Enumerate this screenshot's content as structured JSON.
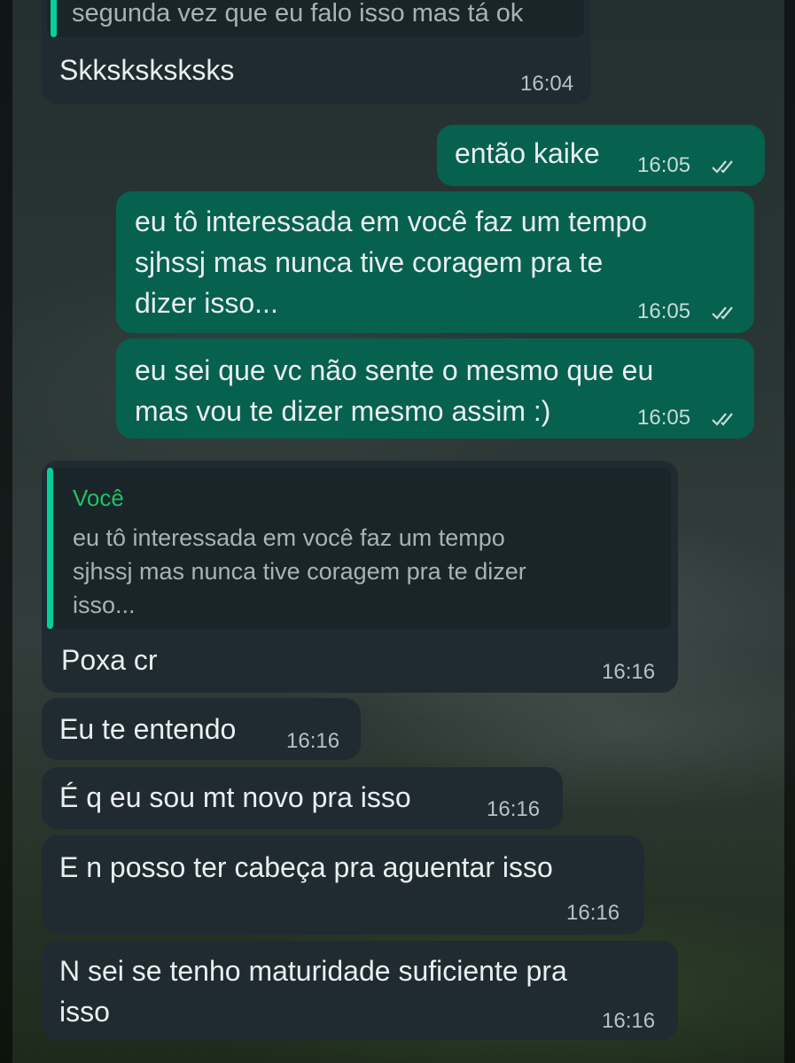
{
  "messages": [
    {
      "quote_text": "segunda vez que eu falo isso mas tá ok",
      "text": "Skksksksksks",
      "time": "16:04"
    },
    {
      "text": "então kaike",
      "time": "16:05"
    },
    {
      "lines": [
        "eu tô interessada em você faz um tempo",
        "sjhssj mas nunca tive coragem pra te",
        "dizer isso..."
      ],
      "time": "16:05"
    },
    {
      "lines": [
        "eu sei que vc não sente o mesmo que eu",
        "mas vou te dizer mesmo assim :)"
      ],
      "time": "16:05"
    },
    {
      "quote_author": "Você",
      "quote_lines": [
        "eu tô interessada em você faz um tempo",
        "sjhssj mas nunca tive coragem pra te dizer",
        "isso..."
      ],
      "text": "Poxa cr",
      "time": "16:16"
    },
    {
      "text": "Eu te entendo",
      "time": "16:16"
    },
    {
      "text": "É q eu sou mt novo pra isso",
      "time": "16:16"
    },
    {
      "text": "E n posso ter cabeça pra aguentar isso",
      "time": "16:16"
    },
    {
      "lines": [
        "N sei se tenho maturidade suficiente pra",
        "isso"
      ],
      "time": "16:16"
    }
  ],
  "colors": {
    "incoming_bubble": "#1f2b31",
    "outgoing_bubble": "#06614f",
    "quote_accent": "#06cf9c",
    "quote_author": "#21c063"
  },
  "icons": {
    "read_receipt": "double-check-icon"
  }
}
